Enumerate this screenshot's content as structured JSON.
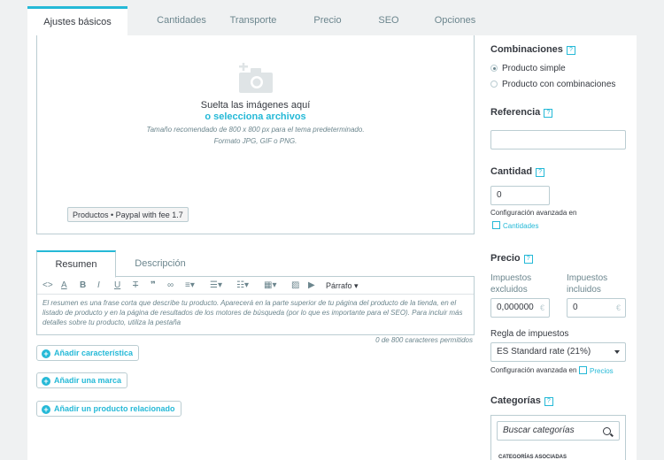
{
  "tabs": [
    {
      "label": "Ajustes básicos",
      "active": true
    },
    {
      "label": "Cantidades",
      "active": false
    },
    {
      "label": "Transporte",
      "active": false
    },
    {
      "label": "Precio",
      "active": false
    },
    {
      "label": "SEO",
      "active": false
    },
    {
      "label": "Opciones",
      "active": false
    }
  ],
  "dropzone": {
    "title": "Suelta las imágenes aquí",
    "link": "o selecciona archivos",
    "note1": "Tamaño recomendado de 800 x 800 px para el tema predeterminado.",
    "note2": "Formato JPG, GIF o PNG.",
    "badge": "Productos • Paypal with fee 1.7"
  },
  "description_tabs": [
    {
      "label": "Resumen",
      "active": true
    },
    {
      "label": "Descripción",
      "active": false
    }
  ],
  "editor": {
    "format_label": "Párrafo",
    "text": "El resumen es una frase corta que describe tu producto. Aparecerá en la parte superior de tu página del producto de la tienda, en el listado de producto y en la página de resultados de los motores de búsqueda (por lo que es importante para el SEO). Para incluir más detalles sobre tu producto, utiliza la pestaña",
    "char_count": "0 de 800 caracteres permitidos"
  },
  "buttons": {
    "add_feature": "Añadir característica",
    "add_brand": "Añadir una marca",
    "add_related": "Añadir un producto relacionado"
  },
  "sidebar": {
    "combinations": {
      "title": "Combinaciones",
      "help": "?",
      "options": [
        "Producto simple",
        "Producto con combinaciones"
      ],
      "selected": 0
    },
    "reference": {
      "title": "Referencia",
      "help": "?",
      "value": ""
    },
    "quantity": {
      "title": "Cantidad",
      "help": "?",
      "value": "0",
      "advanced_text": "Configuración avanzada en",
      "advanced_link": "Cantidades"
    },
    "price": {
      "title": "Precio",
      "help": "?",
      "tax_excl_label": "Impuestos excluidos",
      "tax_excl_value": "0,000000",
      "tax_incl_label": "Impuestos incluidos",
      "tax_incl_value": "0",
      "currency": "€",
      "tax_rule_label": "Regla de impuestos",
      "tax_rule_value": "ES Standard rate (21%)",
      "advanced_text": "Configuración avanzada en",
      "advanced_link": "Precios"
    },
    "categories": {
      "title": "Categorías",
      "help": "?",
      "search_placeholder": "Buscar categorías",
      "associated_label": "CATEGORÍAS ASOCIADAS"
    }
  },
  "colors": {
    "accent": "#25b9d7",
    "text": "#363a41",
    "muted": "#6c868e",
    "border": "#bbcdd2",
    "background": "#eff1f2"
  }
}
